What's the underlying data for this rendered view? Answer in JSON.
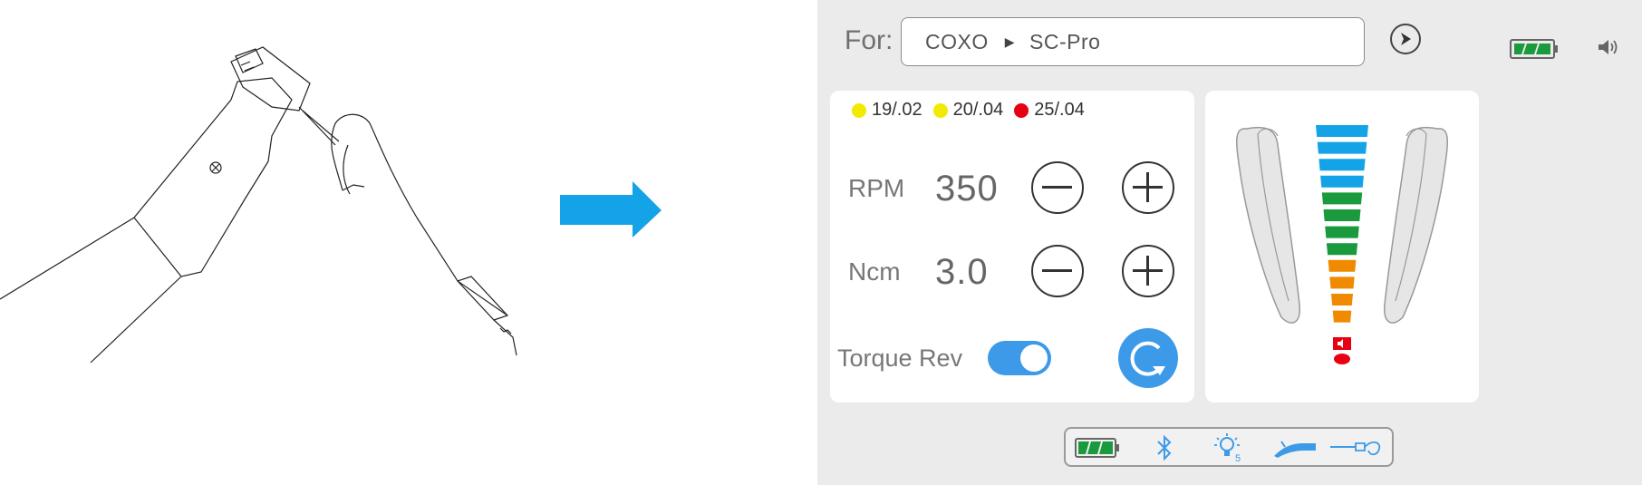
{
  "header": {
    "for_label": "For:",
    "brand": "COXO",
    "model": "SC-Pro"
  },
  "files": [
    {
      "label": "19/.02",
      "color": "#f2ea00"
    },
    {
      "label": "20/.04",
      "color": "#f2ea00"
    },
    {
      "label": "25/.04",
      "color": "#e60012"
    }
  ],
  "rpm": {
    "label": "RPM",
    "value": "350"
  },
  "ncm": {
    "label": "Ncm",
    "value": "3.0"
  },
  "torque_rev": {
    "label": "Torque Rev",
    "enabled": true
  },
  "apex_meter": {
    "colors": {
      "blue": "#13a3e6",
      "green": "#1a9a3c",
      "orange": "#f08a00",
      "red": "#e60012"
    },
    "bars": [
      "blue",
      "blue",
      "blue",
      "blue",
      "green",
      "green",
      "green",
      "green",
      "orange",
      "orange",
      "orange",
      "orange"
    ]
  },
  "status": {
    "battery_icon": "battery-full-icon",
    "sound_icon": "speaker-icon"
  },
  "bottom_bar": [
    "battery-icon",
    "bluetooth-icon",
    "light-level-icon",
    "handpiece-icon",
    "apex-locator-icon"
  ],
  "bottom_light_level": "5",
  "accent": "#3c9ae8"
}
